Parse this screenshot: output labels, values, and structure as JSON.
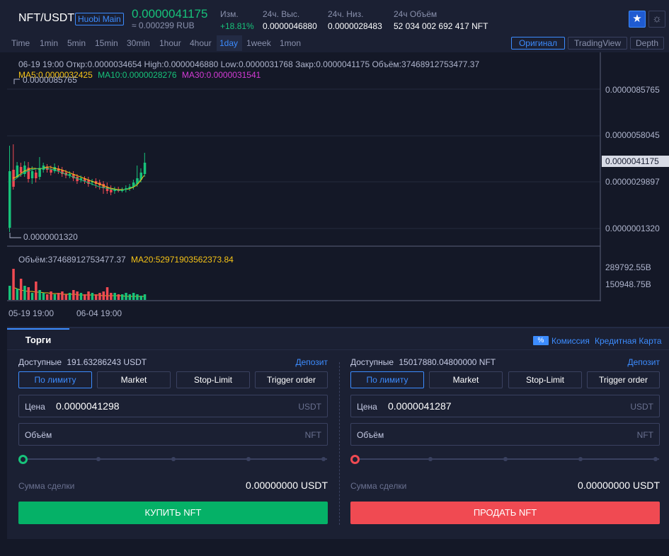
{
  "header": {
    "pair": "NFT/USDT",
    "exchange": "Huobi Main",
    "price": "0.0000041175",
    "price_rub": "≈ 0.000299 RUB",
    "change_label": "Изм.",
    "change_value": "+18.81%",
    "high_label": "24ч. Выс.",
    "high_value": "0.0000046880",
    "low_label": "24ч. Низ.",
    "low_value": "0.0000028483",
    "vol_label": "24ч Объём",
    "vol_value": "52 034 002 692 417 NFT",
    "star_icon": "★",
    "theme_icon": "☼"
  },
  "intervals": [
    "Time",
    "1min",
    "5min",
    "15min",
    "30min",
    "1hour",
    "4hour",
    "1day",
    "1week",
    "1mon"
  ],
  "active_interval": "1day",
  "views": [
    "Оригинал",
    "TradingView",
    "Depth"
  ],
  "active_view": "Оригинал",
  "chart": {
    "ohlc": "06-19 19:00   Откр:0.0000034654  High:0.0000046880  Low:0.0000031768  Закр:0.0000041175  Объём:37468912753477.37",
    "ma5": "MA5:0.0000032425",
    "ma10": "MA10:0.0000028276",
    "ma30": "MA30:0.0000031541",
    "max_annot": "0.0000085765",
    "min_annot": "0.0000001320",
    "axis": [
      "0.0000085765",
      "0.0000058045",
      "0.0000029897",
      "0.0000001320"
    ],
    "current": "0.0000041175",
    "vol_info": "Объём:37468912753477.37",
    "ma20": "MA20:52971903562373.84",
    "vol_axis": [
      "289792.55B",
      "150948.75B"
    ],
    "dates": [
      "05-19 19:00",
      "06-04 19:00"
    ],
    "colors": {
      "up": "#17c27a",
      "down": "#f04a52",
      "ma5": "#f5c316",
      "ma10": "#17c27a",
      "ma30": "#d43bd6"
    }
  },
  "trade": {
    "tab": "Торги",
    "pct_icon": "%",
    "commission": "Комиссия",
    "credit_card": "Кредитная Карта",
    "order_types": [
      "По лимиту",
      "Market",
      "Stop-Limit",
      "Trigger order"
    ],
    "buy": {
      "avail_label": "Доступные",
      "avail_value": "191.63286243 USDT",
      "deposit": "Депозит",
      "price_label": "Цена",
      "price_value": "0.0000041298",
      "price_unit": "USDT",
      "amount_label": "Объём",
      "amount_unit": "NFT",
      "sum_label": "Сумма сделки",
      "sum_value": "0.00000000 USDT",
      "button": "КУПИТЬ NFT"
    },
    "sell": {
      "avail_label": "Доступные",
      "avail_value": "15017880.04800000 NFT",
      "deposit": "Депозит",
      "price_label": "Цена",
      "price_value": "0.0000041287",
      "price_unit": "USDT",
      "amount_label": "Объём",
      "amount_unit": "NFT",
      "sum_label": "Сумма сделки",
      "sum_value": "0.00000000 USDT",
      "button": "ПРОДАТЬ NFT"
    }
  }
}
